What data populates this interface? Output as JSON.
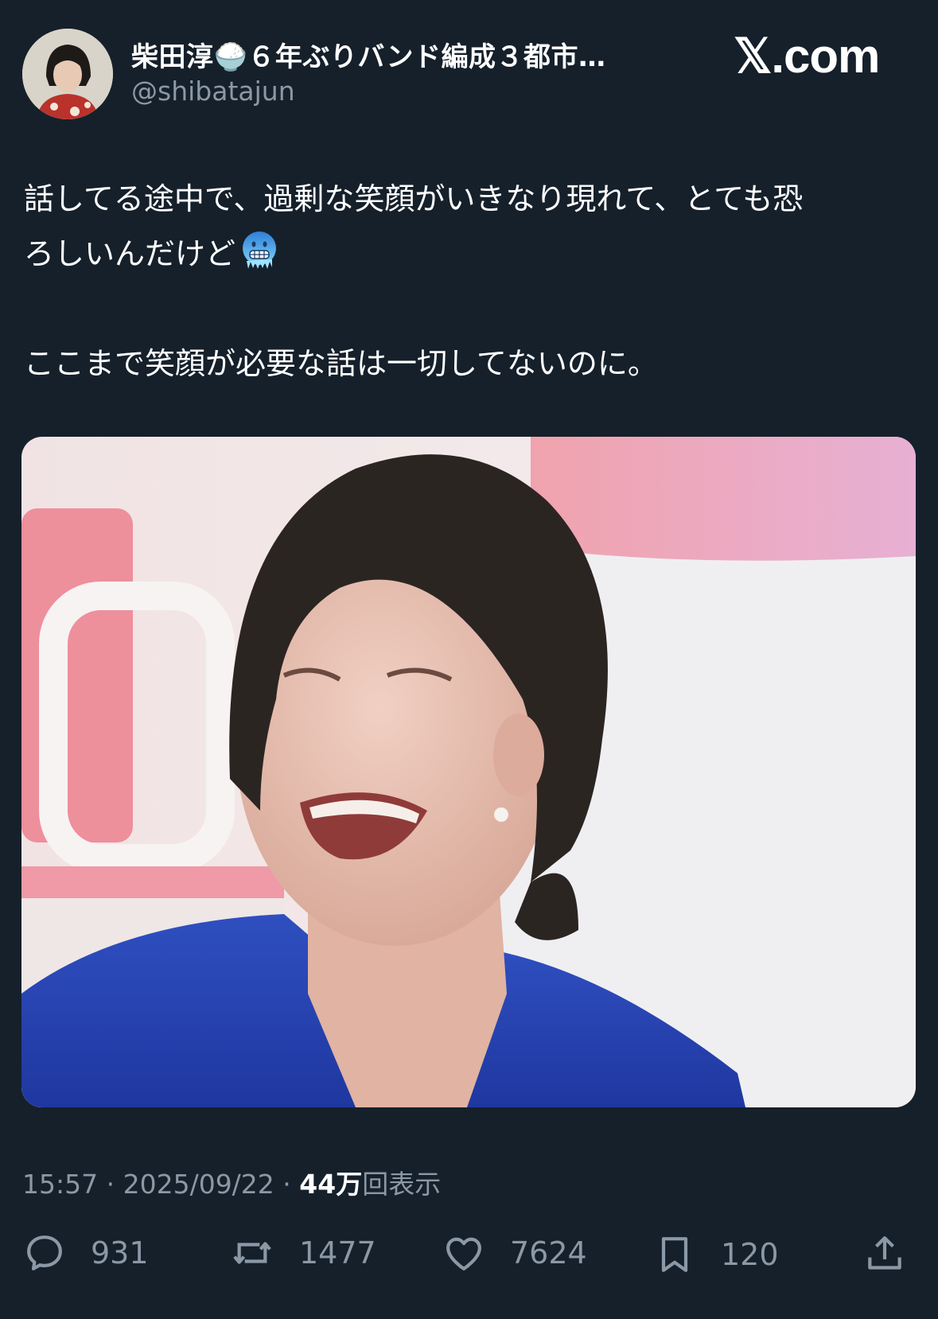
{
  "header": {
    "display_name": "柴田淳🍚６年ぶりバンド編成３都市…",
    "handle": "@shibatajun",
    "brand": "𝕏.com"
  },
  "tweet": {
    "line1": "話してる途中で、過剰な笑顔がいきなり現れて、とても恐",
    "line2": "ろしいんだけど",
    "emoji": "cold-face-emoji",
    "line3": "ここまで笑顔が必要な話は一切してないのに。"
  },
  "meta": {
    "time": "15:57",
    "sep1": " · ",
    "date": "2025/09/22",
    "sep2": " · ",
    "views": "44万",
    "views_suffix": "回表示"
  },
  "actions": {
    "replies": "931",
    "reposts": "1477",
    "likes": "7624",
    "bookmarks": "120"
  },
  "icons": [
    "reply-icon",
    "repost-icon",
    "like-icon",
    "bookmark-icon",
    "share-icon"
  ],
  "colors": {
    "background": "#15202b",
    "secondary_text": "#8b98a5",
    "text": "#ffffff"
  }
}
